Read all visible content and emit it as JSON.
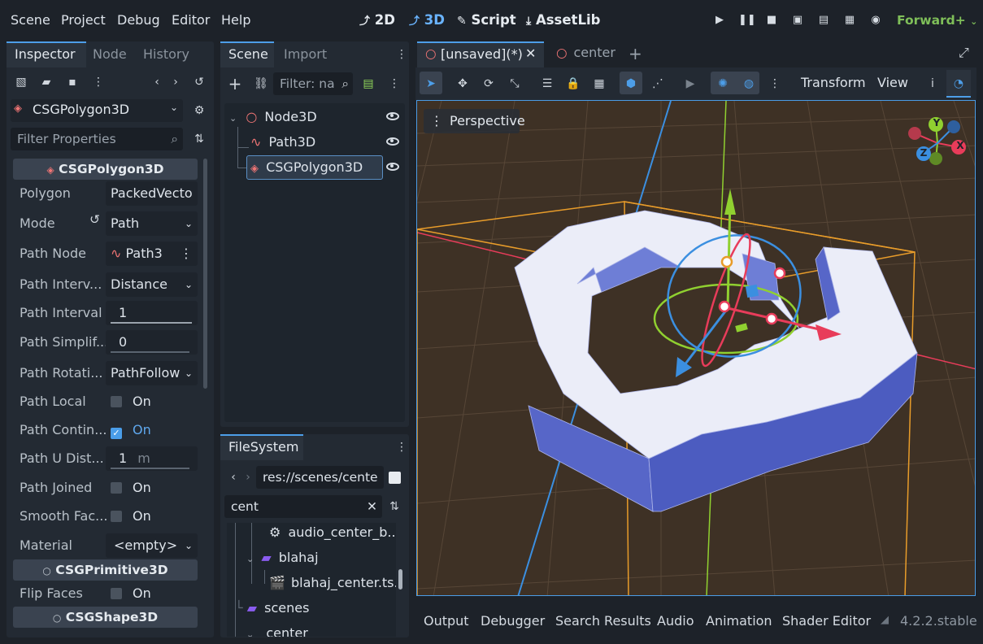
{
  "menubar": {
    "items": [
      "Scene",
      "Project",
      "Debug",
      "Editor",
      "Help"
    ],
    "modes": {
      "2d": "2D",
      "3d": "3D",
      "script": "Script",
      "assetlib": "AssetLib"
    },
    "renderer": "Forward+"
  },
  "inspector": {
    "tabs": [
      "Inspector",
      "Node",
      "History"
    ],
    "node_type": "CSGPolygon3D",
    "filter_placeholder": "Filter Properties",
    "section_main": "CSGPolygon3D",
    "properties": [
      {
        "label": "Polygon",
        "value": "PackedVecto"
      },
      {
        "label": "Mode",
        "value": "Path"
      },
      {
        "label": "Path Node",
        "value": "Path3"
      },
      {
        "label": "Path Interv...",
        "value": "Distance"
      },
      {
        "label": "Path Interval",
        "value": "1"
      },
      {
        "label": "Path Simplif...",
        "value": "0"
      },
      {
        "label": "Path Rotati...",
        "value": "PathFollow"
      },
      {
        "label": "Path Local",
        "value": "On"
      },
      {
        "label": "Path Contin...",
        "value": "On"
      },
      {
        "label": "Path U Dist...",
        "value": "1",
        "unit": "m"
      },
      {
        "label": "Path Joined",
        "value": "On"
      },
      {
        "label": "Smooth Fac...",
        "value": "On"
      },
      {
        "label": "Material",
        "value": "<empty>"
      }
    ],
    "section_primitive": "CSGPrimitive3D",
    "flip_faces": {
      "label": "Flip Faces",
      "value": "On"
    },
    "section_shape": "CSGShape3D"
  },
  "scene": {
    "tabs": [
      "Scene",
      "Import"
    ],
    "filter_placeholder": "Filter: na",
    "nodes": [
      "Node3D",
      "Path3D",
      "CSGPolygon3D"
    ]
  },
  "filesystem": {
    "tab": "FileSystem",
    "path": "res://scenes/cente",
    "search": "cent",
    "items": [
      "audio_center_b...",
      "blahaj",
      "blahaj_center.ts...",
      "scenes",
      "center"
    ]
  },
  "editor": {
    "tabs": [
      "[unsaved](*)",
      "center"
    ],
    "toolbar_transform": "Transform",
    "toolbar_view": "View",
    "viewport_label": "Perspective",
    "gizmo_axes": {
      "x": "X",
      "y": "Y",
      "z": "Z"
    }
  },
  "bottom": {
    "tabs": [
      "Output",
      "Debugger",
      "Search Results",
      "Audio",
      "Animation",
      "Shader Editor"
    ],
    "version": "4.2.2.stable"
  },
  "colors": {
    "accent": "#4d9ee8",
    "renderer": "#7fbf59",
    "node_icon": "#f07575"
  }
}
